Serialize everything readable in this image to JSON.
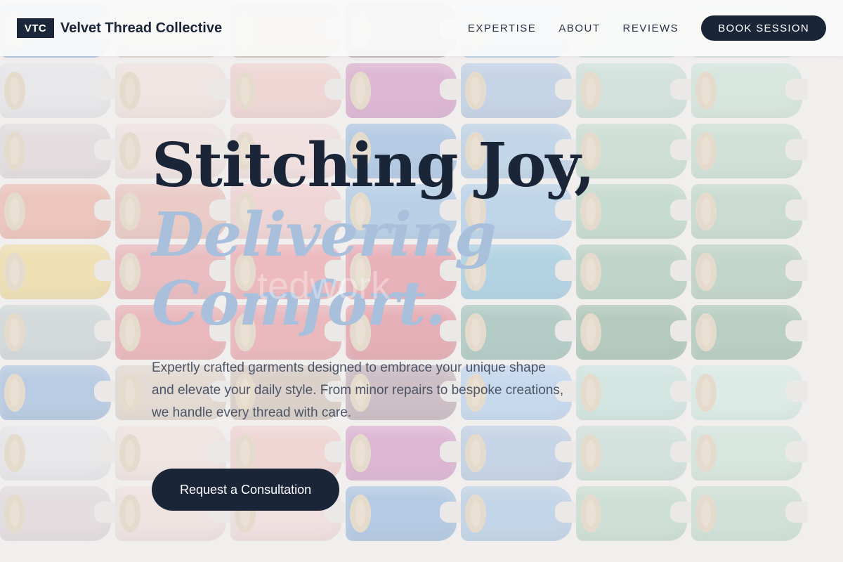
{
  "brand": {
    "badge": "VTC",
    "name": "Velvet Thread Collective"
  },
  "nav": {
    "links": [
      "EXPERTISE",
      "ABOUT",
      "REVIEWS"
    ],
    "cta": "BOOK SESSION"
  },
  "hero": {
    "headline_line1": "Stitching Joy,",
    "headline_accent": "Delivering Comfort.",
    "watermark": "tedwork",
    "description": "Expertly crafted garments designed to embrace your unique shape and elevate your daily style. From minor repairs to bespoke creations, we handle every thread with care.",
    "cta": "Request a Consultation"
  },
  "background": {
    "image": "thread-spools",
    "spool_columns": [
      [
        "#5b8fc7",
        "#d4d4d8",
        "#c9bcc0",
        "#e07c62",
        "#e6c24d",
        "#9fb3b3"
      ],
      [
        "#c9b49e",
        "#e8cfc4",
        "#e8ccc6",
        "#d98b7c",
        "#d8666e",
        "#d85a63"
      ],
      [
        "#b29a86",
        "#e6a9a4",
        "#ebc2c0",
        "#e8a4a2",
        "#e05f6a",
        "#d95c66"
      ],
      [
        "#8c6c7a",
        "#b8579f",
        "#4f8cc9",
        "#5a9ad0",
        "#d84a5d",
        "#cf4355"
      ],
      [
        "#7fb2e3",
        "#7aa3cf",
        "#75a7d5",
        "#6aa6d9",
        "#4aa0c8",
        "#4b8e7d"
      ],
      [
        "#9ed2c4",
        "#9ec9b6",
        "#91c2a4",
        "#7fb897",
        "#6ca685",
        "#4c8a66"
      ],
      [
        "#b5e0d0",
        "#a8d2bd",
        "#98c6ad",
        "#86b89c",
        "#73a888",
        "#5b9674"
      ]
    ]
  },
  "colors": {
    "navy": "#1b2538",
    "accent_blue": "#a9c0dc",
    "body_text": "#4b5567"
  }
}
